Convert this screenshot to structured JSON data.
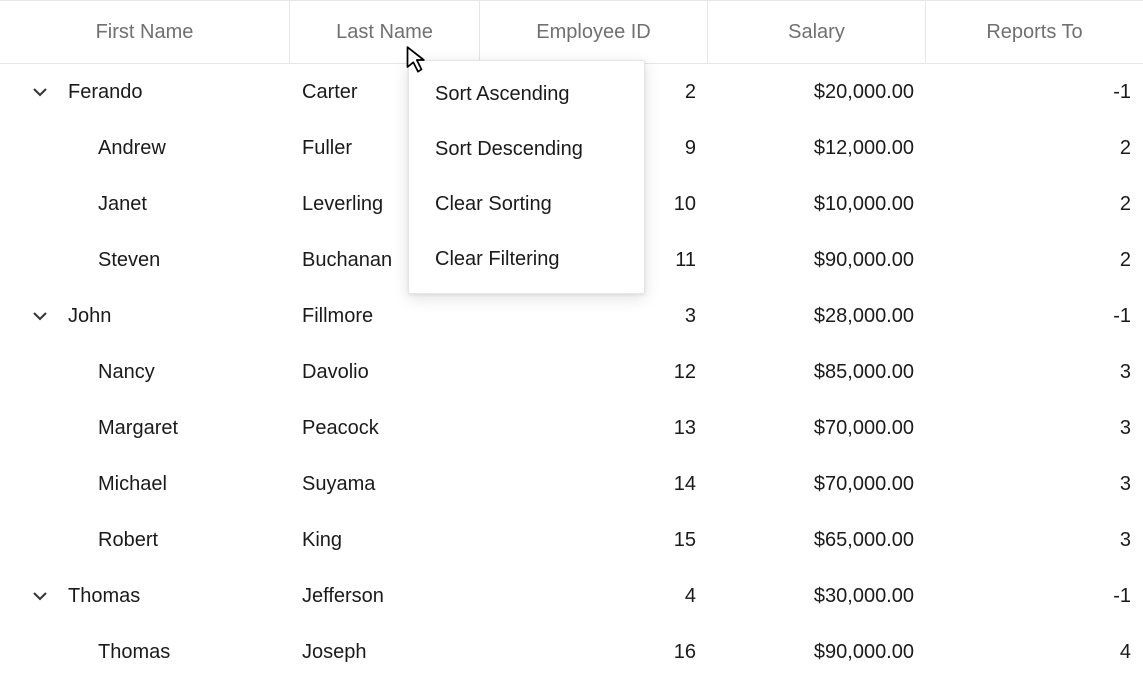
{
  "columns": {
    "first_name": "First Name",
    "last_name": "Last Name",
    "employee_id": "Employee ID",
    "salary": "Salary",
    "reports_to": "Reports To"
  },
  "rows": [
    {
      "level": 0,
      "expanded": true,
      "first_name": "Ferando",
      "last_name": "Carter",
      "employee_id": "2",
      "salary": "$20,000.00",
      "reports_to": "-1"
    },
    {
      "level": 1,
      "expanded": false,
      "first_name": "Andrew",
      "last_name": "Fuller",
      "employee_id": "9",
      "salary": "$12,000.00",
      "reports_to": "2"
    },
    {
      "level": 1,
      "expanded": false,
      "first_name": "Janet",
      "last_name": "Leverling",
      "employee_id": "10",
      "salary": "$10,000.00",
      "reports_to": "2"
    },
    {
      "level": 1,
      "expanded": false,
      "first_name": "Steven",
      "last_name": "Buchanan",
      "employee_id": "11",
      "salary": "$90,000.00",
      "reports_to": "2"
    },
    {
      "level": 0,
      "expanded": true,
      "first_name": "John",
      "last_name": "Fillmore",
      "employee_id": "3",
      "salary": "$28,000.00",
      "reports_to": "-1"
    },
    {
      "level": 1,
      "expanded": false,
      "first_name": "Nancy",
      "last_name": "Davolio",
      "employee_id": "12",
      "salary": "$85,000.00",
      "reports_to": "3"
    },
    {
      "level": 1,
      "expanded": false,
      "first_name": "Margaret",
      "last_name": "Peacock",
      "employee_id": "13",
      "salary": "$70,000.00",
      "reports_to": "3"
    },
    {
      "level": 1,
      "expanded": false,
      "first_name": "Michael",
      "last_name": "Suyama",
      "employee_id": "14",
      "salary": "$70,000.00",
      "reports_to": "3"
    },
    {
      "level": 1,
      "expanded": false,
      "first_name": "Robert",
      "last_name": "King",
      "employee_id": "15",
      "salary": "$65,000.00",
      "reports_to": "3"
    },
    {
      "level": 0,
      "expanded": true,
      "first_name": "Thomas",
      "last_name": "Jefferson",
      "employee_id": "4",
      "salary": "$30,000.00",
      "reports_to": "-1"
    },
    {
      "level": 1,
      "expanded": false,
      "first_name": "Thomas",
      "last_name": "Joseph",
      "employee_id": "16",
      "salary": "$90,000.00",
      "reports_to": "4"
    }
  ],
  "context_menu": {
    "items": [
      {
        "label": "Sort Ascending"
      },
      {
        "label": "Sort Descending"
      },
      {
        "label": "Clear Sorting"
      },
      {
        "label": "Clear Filtering"
      }
    ]
  }
}
